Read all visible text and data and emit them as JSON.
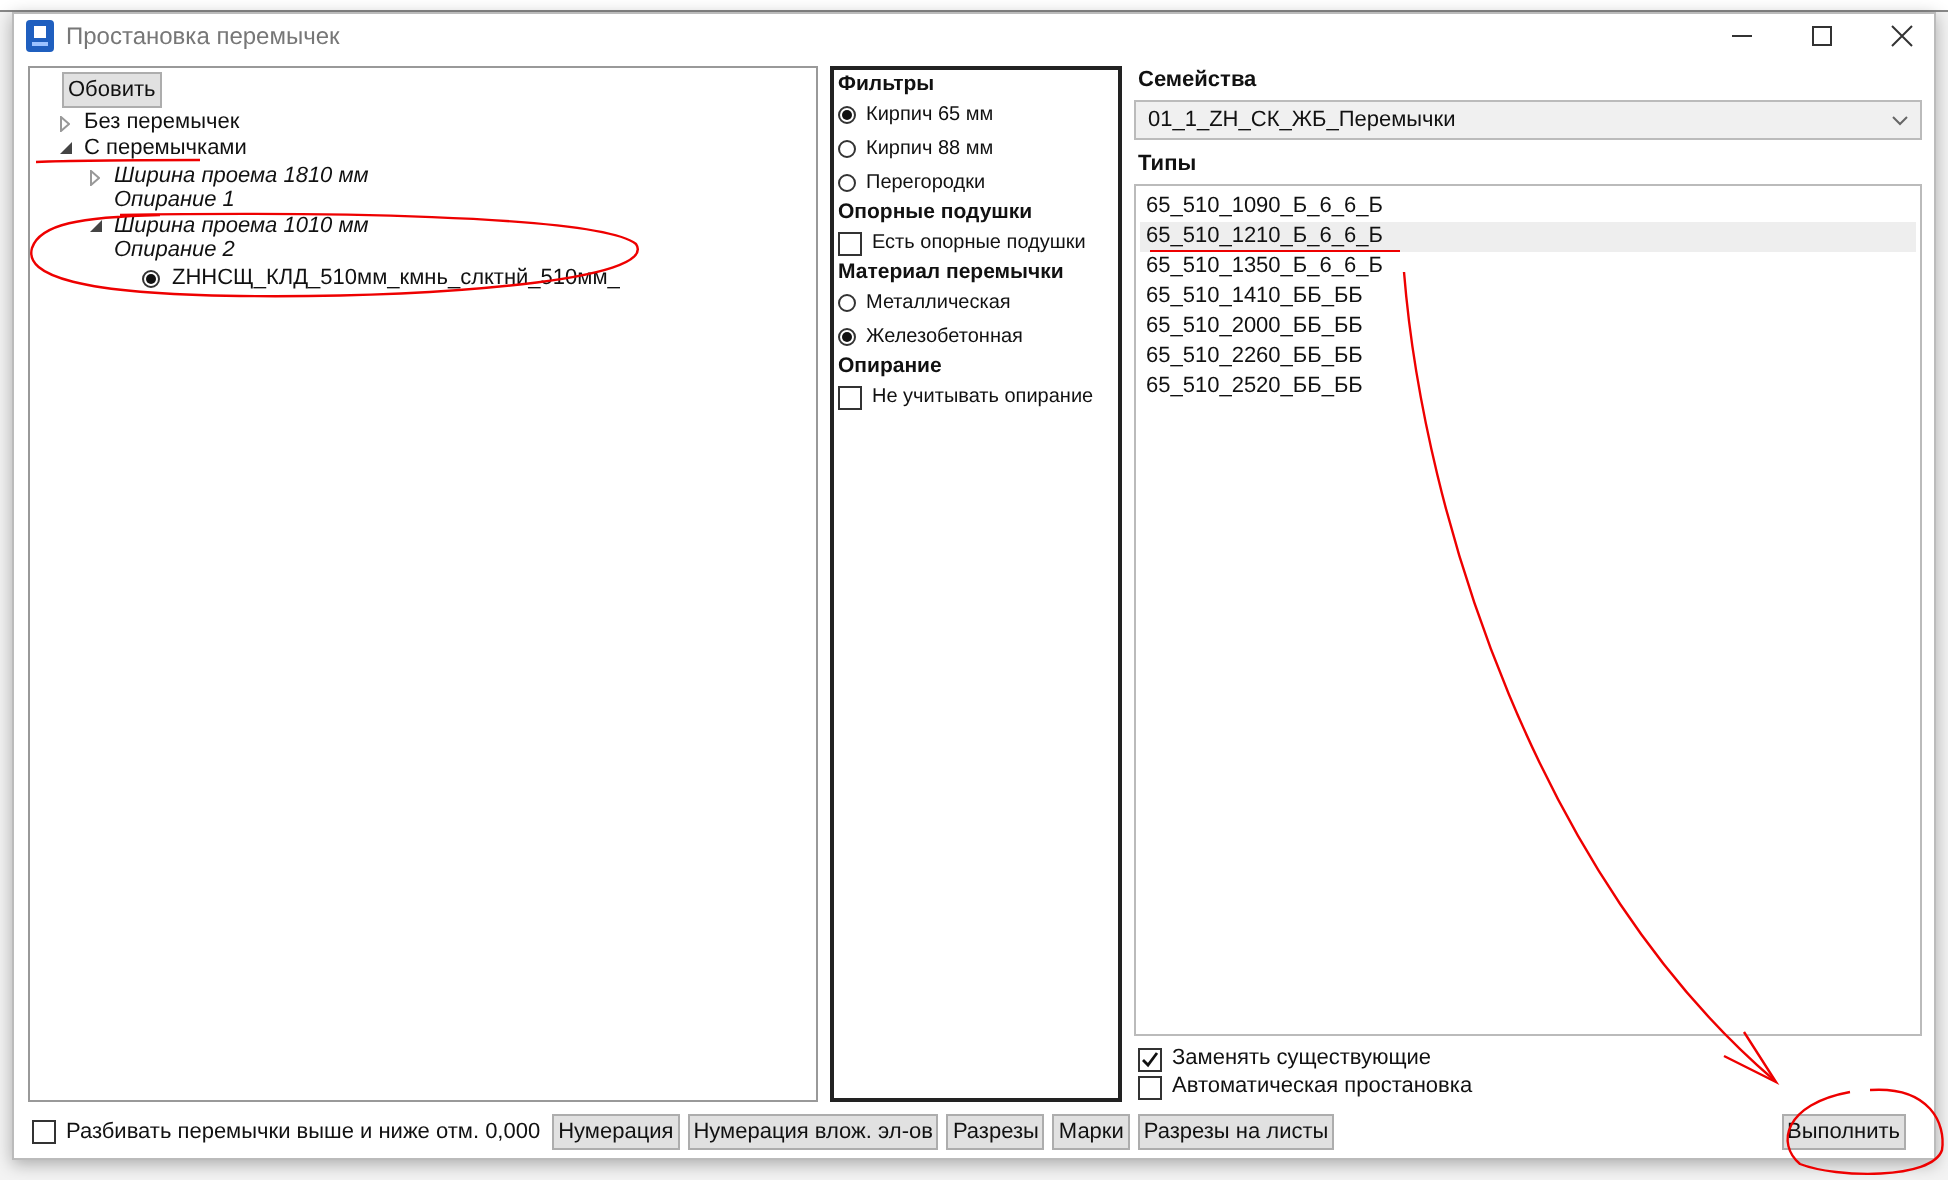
{
  "window": {
    "title": "Простановка перемычек"
  },
  "tree": {
    "refresh_button": "Обовить",
    "nodes": [
      {
        "kind": "folder",
        "lines": [
          "Без перемычек"
        ],
        "expanded": false
      },
      {
        "kind": "folder",
        "lines": [
          "С перемычками"
        ],
        "expanded": true,
        "children": [
          {
            "kind": "group",
            "lines": [
              "Ширина проема 1810 мм",
              "Опирание 1"
            ],
            "expanded": false
          },
          {
            "kind": "group",
            "lines": [
              "Ширина проема 1010 мм",
              "Опирание 2"
            ],
            "expanded": true,
            "children": [
              {
                "kind": "radio",
                "lines": [
                  "ZHНСЩ_КЛД_510мм_кмнь_слктнй_510мм_"
                ],
                "selected": true
              }
            ]
          }
        ]
      }
    ]
  },
  "filters": [
    {
      "kind": "heading",
      "label": "Фильтры"
    },
    {
      "kind": "radio",
      "label": "Кирпич 65 мм",
      "selected": true
    },
    {
      "kind": "radio",
      "label": "Кирпич 88 мм",
      "selected": false
    },
    {
      "kind": "radio",
      "label": "Перегородки",
      "selected": false
    },
    {
      "kind": "heading",
      "label": "Опорные подушки"
    },
    {
      "kind": "checkbox",
      "label": "Есть опорные подушки",
      "checked": false
    },
    {
      "kind": "heading",
      "label": "Материал перемычки"
    },
    {
      "kind": "radio",
      "label": "Металлическая",
      "selected": false
    },
    {
      "kind": "radio",
      "label": "Железобетонная",
      "selected": true
    },
    {
      "kind": "heading",
      "label": "Опирание"
    },
    {
      "kind": "checkbox",
      "label": "Не учитывать опирание",
      "checked": false
    }
  ],
  "families": {
    "label": "Семейства",
    "value": "01_1_ZH_СК_ЖБ_Перемычки"
  },
  "types": {
    "label": "Типы",
    "items": [
      {
        "label": "65_510_1090_Б_6_6_Б",
        "selected": false
      },
      {
        "label": "65_510_1210_Б_6_6_Б",
        "selected": true
      },
      {
        "label": "65_510_1350_Б_6_6_Б",
        "selected": false
      },
      {
        "label": "65_510_1410_ББ_ББ",
        "selected": false
      },
      {
        "label": "65_510_2000_ББ_ББ",
        "selected": false
      },
      {
        "label": "65_510_2260_ББ_ББ",
        "selected": false
      },
      {
        "label": "65_510_2520_ББ_ББ",
        "selected": false
      }
    ]
  },
  "options": [
    {
      "label": "Заменять существующие",
      "checked": true
    },
    {
      "label": "Автоматическая простановка",
      "checked": false
    }
  ],
  "bottom": {
    "split_checkbox": {
      "label": "Разбивать перемычки выше и ниже отм. 0,000",
      "checked": false
    },
    "buttons": [
      "Нумерация",
      "Нумерация влож. эл-ов",
      "Разрезы",
      "Марки",
      "Разрезы на листы"
    ],
    "run_button": "Выполнить"
  }
}
